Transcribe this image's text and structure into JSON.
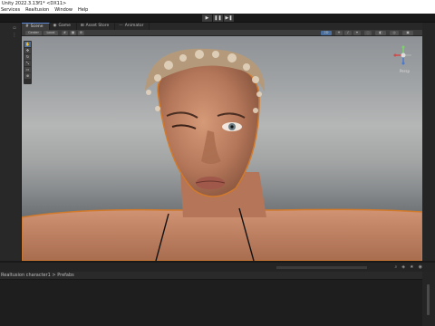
{
  "window": {
    "title": "Unity 2022.3.13f1* <DX11>"
  },
  "menu": [
    "Services",
    "Realtusion",
    "Window",
    "Help"
  ],
  "playbar": {
    "play": "▶",
    "pause": "❚❚",
    "step": "▶❚"
  },
  "tabs": [
    {
      "icon": "#",
      "label": "Scene"
    },
    {
      "icon": "◉",
      "label": "Game"
    },
    {
      "icon": "⊞",
      "label": "Asset Store"
    },
    {
      "icon": "⋯",
      "label": "Animator"
    }
  ],
  "scene_toolbar": {
    "shading": "Center",
    "pivot": "Local",
    "icons": [
      "#",
      "▦",
      "⚙",
      "▾"
    ]
  },
  "gizmo": {
    "label": "Persp"
  },
  "project": {
    "breadcrumb": "Realtusion character1 > Prefabs"
  }
}
